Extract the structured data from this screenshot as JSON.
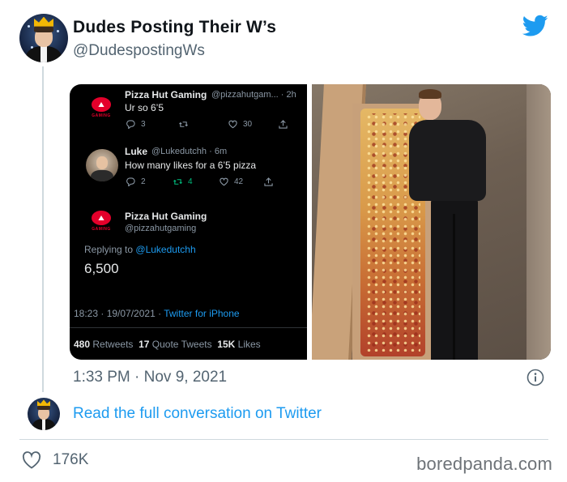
{
  "header": {
    "display_name": "Dudes Posting Their W’s",
    "handle": "@DudespostingWs"
  },
  "embedded_thread": {
    "tweet1": {
      "name": "Pizza Hut Gaming",
      "handle_time": "@pizzahutgam... · 2h",
      "text": "Ur so 6’5",
      "replies": "3",
      "retweets": "",
      "likes": "30"
    },
    "tweet2": {
      "name": "Luke",
      "handle_time": "@Lukedutchh · 6m",
      "text": "How many likes for a 6’5 pizza",
      "replies": "2",
      "retweets": "4",
      "likes": "42"
    },
    "main_tweet": {
      "name": "Pizza Hut Gaming",
      "handle": "@pizzahutgaming",
      "replying_prefix": "Replying to",
      "replying_to": "@Lukedutchh",
      "text": "6,500",
      "time_date": "18:23 · 19/07/2021 · ",
      "client": "Twitter for iPhone",
      "retweets_count": "480",
      "retweets_label": "Retweets",
      "quotes_count": "17",
      "quotes_label": "Quote Tweets",
      "likes_count": "15K",
      "likes_label": "Likes"
    },
    "logo_text": "GAMING"
  },
  "timestamp": "1:33 PM · Nov 9, 2021",
  "read_link": "Read the full conversation on Twitter",
  "likes": "176K",
  "watermark": "boredpanda.com",
  "colors": {
    "twitter_blue": "#1d9bf0",
    "secondary_text": "#536471",
    "pizza_hut_red": "#e4002b"
  },
  "icons": [
    "twitter-bird-icon",
    "info-icon",
    "heart-icon",
    "reply-icon",
    "retweet-icon",
    "like-icon",
    "share-icon"
  ]
}
